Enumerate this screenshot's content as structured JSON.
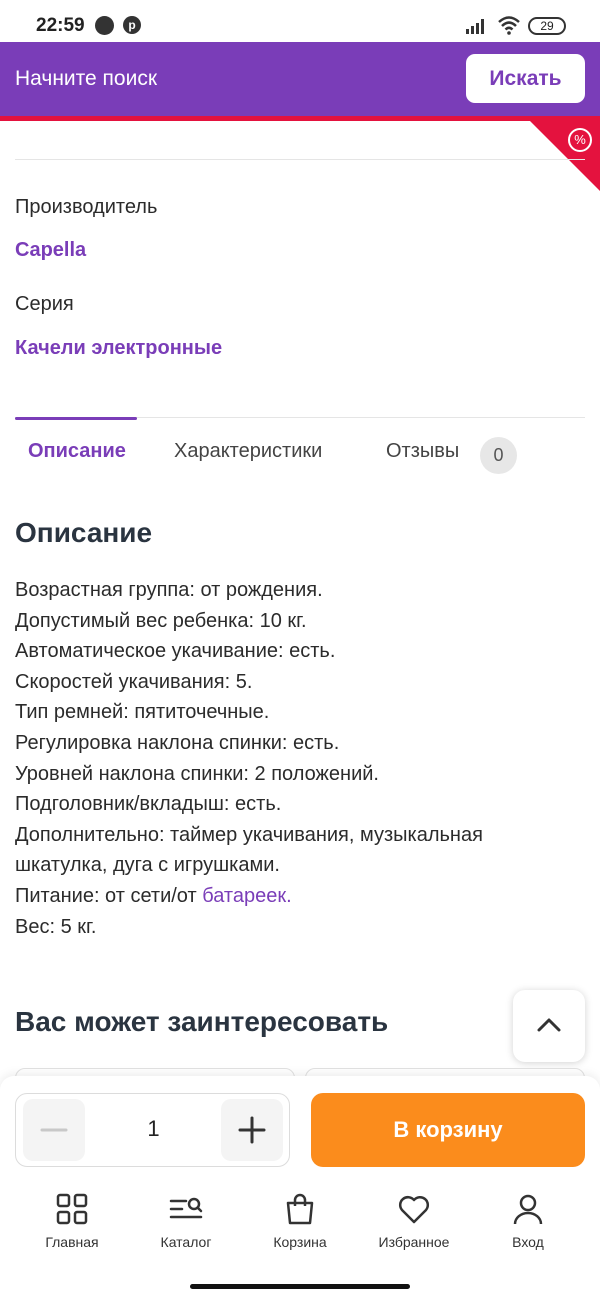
{
  "status_bar": {
    "time": "22:59",
    "battery": "29"
  },
  "header": {
    "search_placeholder": "Начните поиск",
    "search_button": "Искать"
  },
  "attributes": [
    {
      "label": "Производитель",
      "value": "Capella"
    },
    {
      "label": "Серия",
      "value": "Качели электронные"
    }
  ],
  "tabs": [
    {
      "label": "Описание",
      "active": true
    },
    {
      "label": "Характеристики",
      "active": false
    },
    {
      "label": "Отзывы",
      "active": false,
      "badge": "0"
    }
  ],
  "description": {
    "title": "Описание",
    "lines": [
      "Возрастная группа: от рождения.",
      "Допустимый вес ребенка: 10 кг.",
      "Автоматическое укачивание: есть.",
      "Скоростей укачивания: 5.",
      "Тип ремней: пятиточечные.",
      "Регулировка наклона спинки: есть.",
      "Уровней наклона спинки: 2 положений.",
      "Подголовник/вкладыш: есть.",
      "Дополнительно: таймер укачивания, музыкальная",
      "шкатулка, дуга с игрушками."
    ],
    "power_prefix": "Питание: от сети/от ",
    "power_link": "батареек.",
    "weight": "Вес: 5 кг."
  },
  "recommend_title": "Вас может заинтересовать",
  "purchase": {
    "quantity": "1",
    "cart_button": "В корзину"
  },
  "nav": [
    {
      "label": "Главная",
      "icon": "grid-icon"
    },
    {
      "label": "Каталог",
      "icon": "catalog-search-icon"
    },
    {
      "label": "Корзина",
      "icon": "shopping-bag-icon"
    },
    {
      "label": "Избранное",
      "icon": "heart-icon"
    },
    {
      "label": "Вход",
      "icon": "user-icon"
    }
  ],
  "colors": {
    "brand": "#7a3db8",
    "accent": "#fb8c1c",
    "alert": "#e4123e"
  }
}
